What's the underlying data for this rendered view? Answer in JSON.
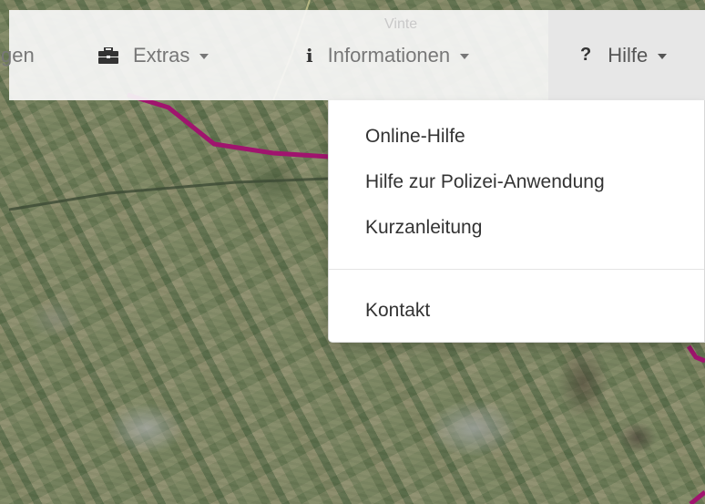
{
  "map": {
    "place_label": "Vinte"
  },
  "navbar": {
    "items": [
      {
        "label": "gen",
        "icon": "none"
      },
      {
        "label": "Extras",
        "icon": "briefcase-icon"
      },
      {
        "label": "Informationen",
        "icon": "info-icon"
      },
      {
        "label": "Hilfe",
        "icon": "question-icon",
        "active": true
      }
    ]
  },
  "dropdown": {
    "items": [
      {
        "label": "Online-Hilfe"
      },
      {
        "label": "Hilfe zur Polizei-Anwendung"
      },
      {
        "label": "Kurzanleitung"
      }
    ],
    "footer_items": [
      {
        "label": "Kontakt"
      }
    ]
  },
  "colors": {
    "navbar_bg": "#f8f8f8",
    "active_bg": "#e7e7e7",
    "nav_text": "#777777",
    "route": "#a0146e"
  }
}
